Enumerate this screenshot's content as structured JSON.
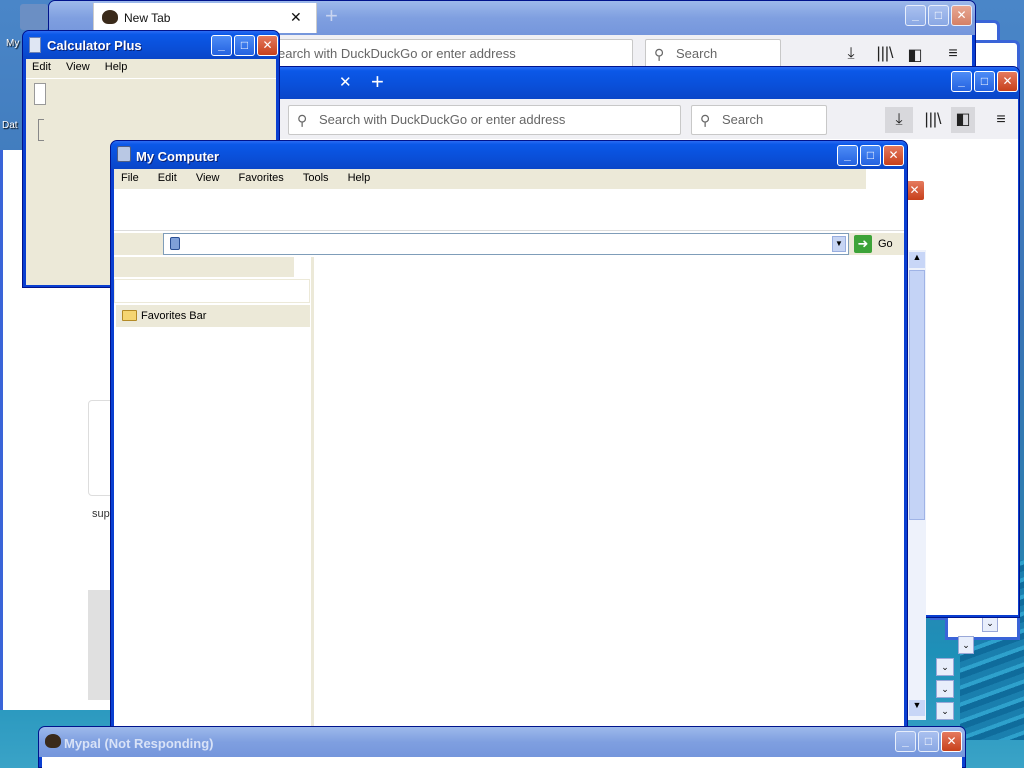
{
  "colors": {
    "xp_title_blue": "#0a4fd8",
    "xp_body": "#ece9d8",
    "desktop": "#3b7fbf",
    "close_red": "#c7401b"
  },
  "desktop": {
    "icon_labels": [
      "My",
      "Dat"
    ]
  },
  "firefox_back": {
    "tab_title": "New Tab",
    "tab_close": "✕",
    "new_tab": "+",
    "url_placeholder": "Search with DuckDuckGo or enter address",
    "url_visible_fragment": "earch with DuckDuckGo or enter address",
    "search_placeholder": "Search",
    "icons": [
      "download-icon",
      "library-icon",
      "sidebar-icon",
      "menu-icon"
    ]
  },
  "firefox_front": {
    "tab_close": "✕",
    "new_tab": "+",
    "url_placeholder": "Search with DuckDuckGo or enter address",
    "search_placeholder": "Search",
    "icons": [
      "download-icon",
      "library-icon",
      "sidebar-icon",
      "menu-icon"
    ]
  },
  "background_text": {
    "sup": "sup"
  },
  "calculator": {
    "title": "Calculator Plus",
    "menu": [
      "Edit",
      "View",
      "Help"
    ]
  },
  "my_computer": {
    "title": "My Computer",
    "menu": [
      "File",
      "Edit",
      "View",
      "Favorites",
      "Tools",
      "Help"
    ],
    "go_label": "Go",
    "favorites_bar": "Favorites Bar"
  },
  "mypal": {
    "title": "Mypal (Not Responding)"
  },
  "window_buttons": {
    "minimize": "_",
    "maximize": "□",
    "close": "✕"
  }
}
